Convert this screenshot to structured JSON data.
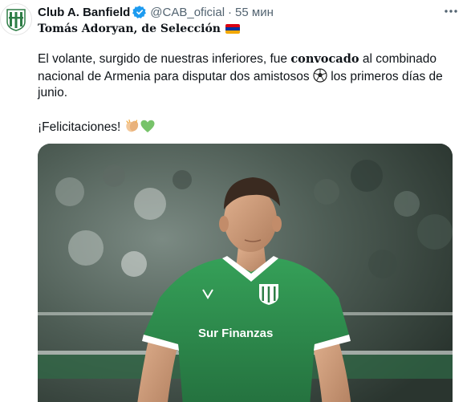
{
  "tweet": {
    "author": {
      "name": "Club A. Banfield",
      "handle": "@CAB_oficial",
      "separator": "·",
      "time": "55 мин",
      "avatar": "banfield-crest-icon",
      "verified_icon": "verified-badge-icon"
    },
    "more_icon": "more-options-icon",
    "headline": {
      "text": "Tomás Adoryan, de Selección",
      "flag": "armenia-flag-icon",
      "flag_colors": [
        "#d90012",
        "#0033a0",
        "#f2a800"
      ]
    },
    "body": {
      "line1_before": "El volante, surgido de nuestras inferiores, fue ",
      "line1_bold": "convocado",
      "line1_after": " al combinado nacional de Armenia para disputar dos amistosos ",
      "ball_icon": "soccer-ball-icon",
      "line1_end": " los primeros días de junio.",
      "line2": "¡Felicitaciones! ",
      "clap_icon": "clapping-hands-icon",
      "heart_icon": "green-heart-icon"
    },
    "media": {
      "shirt_sponsor": "Sur Finanzas",
      "colors": {
        "shirt": "#2f8f4e",
        "trim": "#ffffff",
        "background": "#3c4a43"
      }
    },
    "colors": {
      "text": "#0f1419",
      "secondary": "#536471",
      "verified": "#1d9bf0",
      "heart": "#77c36a"
    }
  }
}
